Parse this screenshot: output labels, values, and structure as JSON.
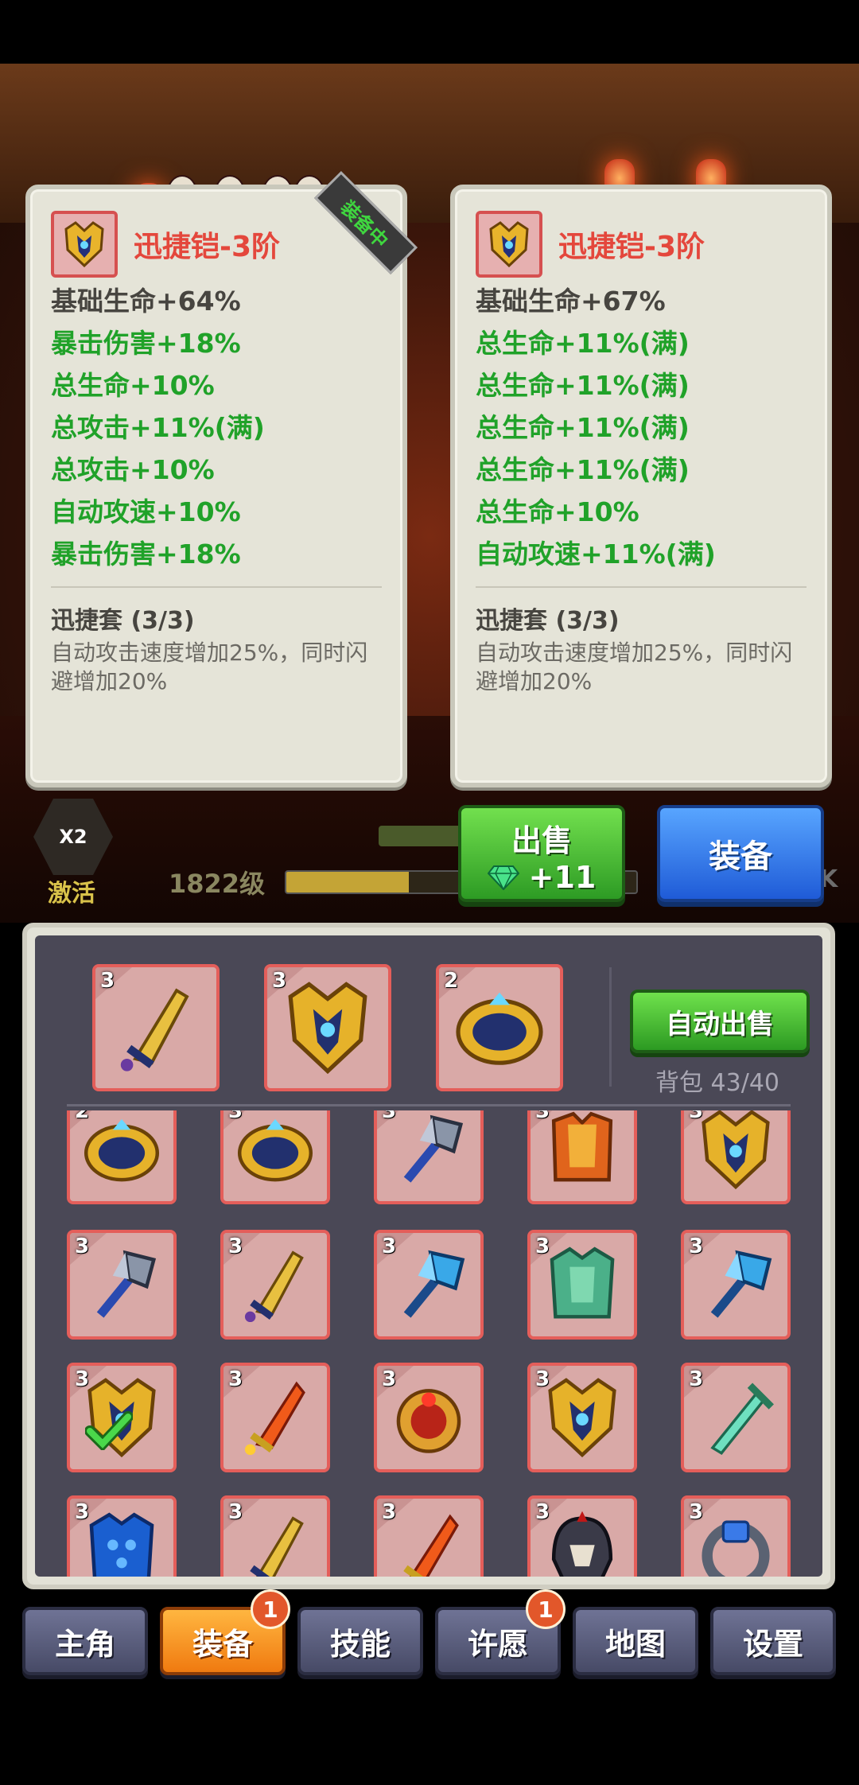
{
  "left_card": {
    "item_name": "迅捷铠-3阶",
    "equipped_tag": "装备中",
    "stats": [
      {
        "text": "基础生命+64%",
        "color": "base"
      },
      {
        "text": "暴击伤害+18%",
        "color": "green"
      },
      {
        "text": "总生命+10%",
        "color": "green"
      },
      {
        "text": "总攻击+11%(满)",
        "color": "green"
      },
      {
        "text": "总攻击+10%",
        "color": "green"
      },
      {
        "text": "自动攻速+10%",
        "color": "green"
      },
      {
        "text": "暴击伤害+18%",
        "color": "green"
      }
    ],
    "set_title": "迅捷套 (3/3)",
    "set_desc": "自动攻击速度增加25%，同时闪避增加20%"
  },
  "right_card": {
    "item_name": "迅捷铠-3阶",
    "stats": [
      {
        "text": "基础生命+67%",
        "color": "base"
      },
      {
        "text": "总生命+11%(满)",
        "color": "green"
      },
      {
        "text": "总生命+11%(满)",
        "color": "green"
      },
      {
        "text": "总生命+11%(满)",
        "color": "green"
      },
      {
        "text": "总生命+11%(满)",
        "color": "green"
      },
      {
        "text": "总生命+10%",
        "color": "green"
      },
      {
        "text": "自动攻速+11%(满)",
        "color": "green"
      }
    ],
    "set_title": "迅捷套 (3/3)",
    "set_desc": "自动攻击速度增加25%，同时闪避增加20%"
  },
  "hud": {
    "multiplier": "X2",
    "activate_label": "激活",
    "level_text": "1822级",
    "xp_fraction": 0.35,
    "k_text": "K"
  },
  "actions": {
    "sell_label": "出售",
    "sell_amount": "+11",
    "equip_label": "装备"
  },
  "inventory": {
    "auto_sell_label": "自动出售",
    "bag_capacity": "背包 43/40",
    "top_items": [
      {
        "level": "3",
        "icon": "dagger-gold-icon"
      },
      {
        "level": "3",
        "icon": "armor-gold-icon"
      },
      {
        "level": "2",
        "icon": "ring-gold-icon"
      }
    ],
    "grid_items": [
      {
        "level": "2",
        "icon": "ring-gold-icon"
      },
      {
        "level": "3",
        "icon": "ring-gold-icon"
      },
      {
        "level": "3",
        "icon": "axe-steel-icon"
      },
      {
        "level": "3",
        "icon": "armor-orange-icon"
      },
      {
        "level": "3",
        "icon": "armor-gold-icon"
      },
      {
        "level": "3",
        "icon": "axe-steel-icon"
      },
      {
        "level": "3",
        "icon": "dagger-gold-icon"
      },
      {
        "level": "3",
        "icon": "axe-ice-icon"
      },
      {
        "level": "3",
        "icon": "armor-green-icon"
      },
      {
        "level": "3",
        "icon": "axe-ice-icon"
      },
      {
        "level": "3",
        "icon": "armor-gold-icon",
        "checked": true
      },
      {
        "level": "3",
        "icon": "dagger-fire-icon"
      },
      {
        "level": "3",
        "icon": "ring-red-icon"
      },
      {
        "level": "3",
        "icon": "armor-gold-icon"
      },
      {
        "level": "3",
        "icon": "sword-jade-icon"
      },
      {
        "level": "3",
        "icon": "armor-blue-icon"
      },
      {
        "level": "3",
        "icon": "dagger-gold-icon"
      },
      {
        "level": "3",
        "icon": "dagger-fire-icon"
      },
      {
        "level": "3",
        "icon": "helmet-dark-icon"
      },
      {
        "level": "3",
        "icon": "ring-blue-icon"
      }
    ]
  },
  "nav": {
    "tabs": [
      {
        "label": "主角",
        "badge": "",
        "active": false,
        "name": "tab-hero"
      },
      {
        "label": "装备",
        "badge": "1",
        "active": true,
        "name": "tab-equipment"
      },
      {
        "label": "技能",
        "badge": "",
        "active": false,
        "name": "tab-skills"
      },
      {
        "label": "许愿",
        "badge": "1",
        "active": false,
        "name": "tab-wish"
      },
      {
        "label": "地图",
        "badge": "",
        "active": false,
        "name": "tab-map"
      },
      {
        "label": "设置",
        "badge": "",
        "active": false,
        "name": "tab-settings"
      }
    ]
  },
  "colors": {
    "item_name_red": "#e4473c",
    "stat_green": "#20a229",
    "sell_green": "#2d9b24",
    "equip_blue": "#1f5bd7",
    "active_tab_orange": "#f07a10"
  }
}
